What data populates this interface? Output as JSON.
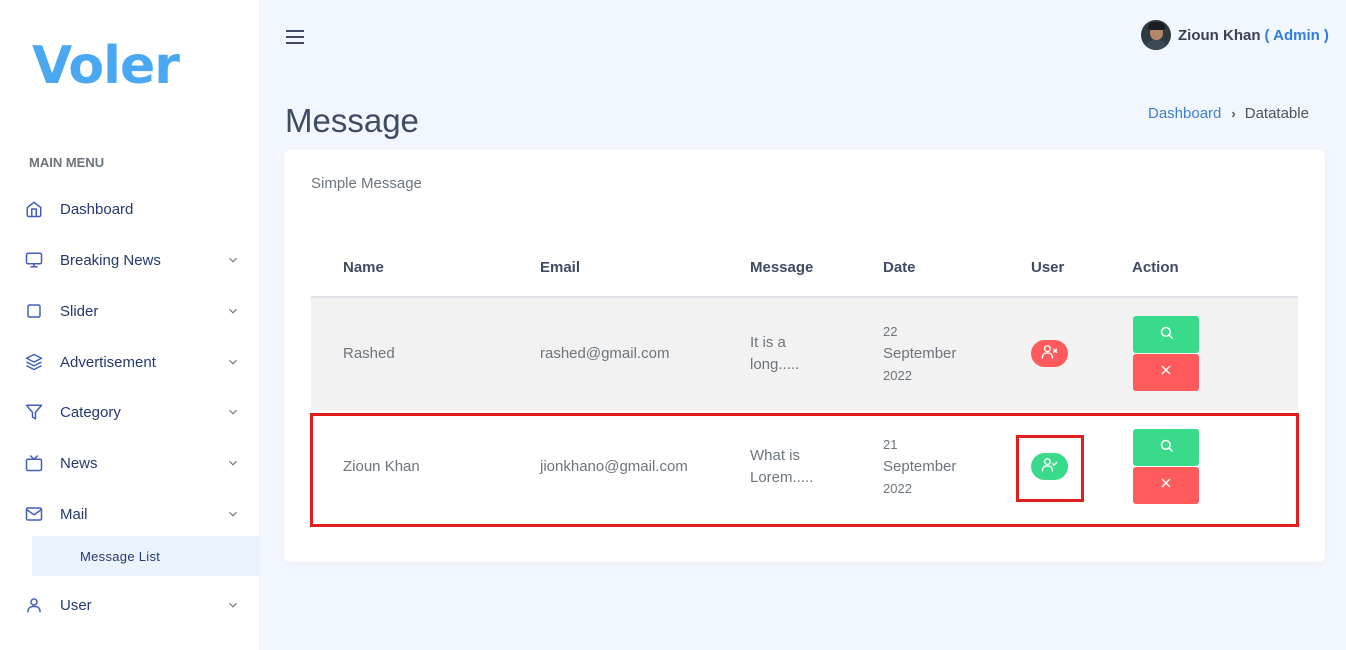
{
  "brand": {
    "logo_text": "Voler"
  },
  "sidebar": {
    "section_title": "MAIN MENU",
    "items": [
      {
        "label": "Dashboard",
        "icon": "home-icon",
        "has_children": false
      },
      {
        "label": "Breaking News",
        "icon": "monitor-icon",
        "has_children": true
      },
      {
        "label": "Slider",
        "icon": "square-icon",
        "has_children": true
      },
      {
        "label": "Advertisement",
        "icon": "layers-icon",
        "has_children": true
      },
      {
        "label": "Category",
        "icon": "filter-icon",
        "has_children": true
      },
      {
        "label": "News",
        "icon": "tv-icon",
        "has_children": true
      },
      {
        "label": "Mail",
        "icon": "mail-icon",
        "has_children": true
      },
      {
        "label": "User",
        "icon": "user-icon",
        "has_children": true
      }
    ],
    "active_submenu": {
      "label": "Message List"
    }
  },
  "topbar": {
    "menu_icon": "hamburger-icon",
    "user_name": "Zioun Khan",
    "user_role": "( Admin )"
  },
  "page": {
    "title": "Message",
    "breadcrumb": {
      "parent": "Dashboard",
      "current": "Datatable"
    }
  },
  "card": {
    "title": "Simple Message",
    "columns": [
      "Name",
      "Email",
      "Message",
      "Date",
      "User",
      "Action"
    ],
    "rows": [
      {
        "name": "Rashed",
        "email": "rashed@gmail.com",
        "message_line1": "It is a",
        "message_line2": "long.....",
        "date_day": "22",
        "date_month": "September",
        "date_year": "2022",
        "user_status_icon": "user-x-icon",
        "user_status_color": "#ff5b5c"
      },
      {
        "name": "Zioun Khan",
        "email": "jionkhano@gmail.com",
        "message_line1": "What is",
        "message_line2": "Lorem.....",
        "date_day": "21",
        "date_month": "September",
        "date_year": "2022",
        "user_status_icon": "user-check-icon",
        "user_status_color": "#39da8a"
      }
    ],
    "actions": {
      "view_icon": "search-icon",
      "delete_icon": "close-icon"
    }
  },
  "colors": {
    "accent": "#3e7fd1",
    "success": "#39da8a",
    "danger": "#ff5b5c",
    "highlight": "#e11d1d"
  }
}
